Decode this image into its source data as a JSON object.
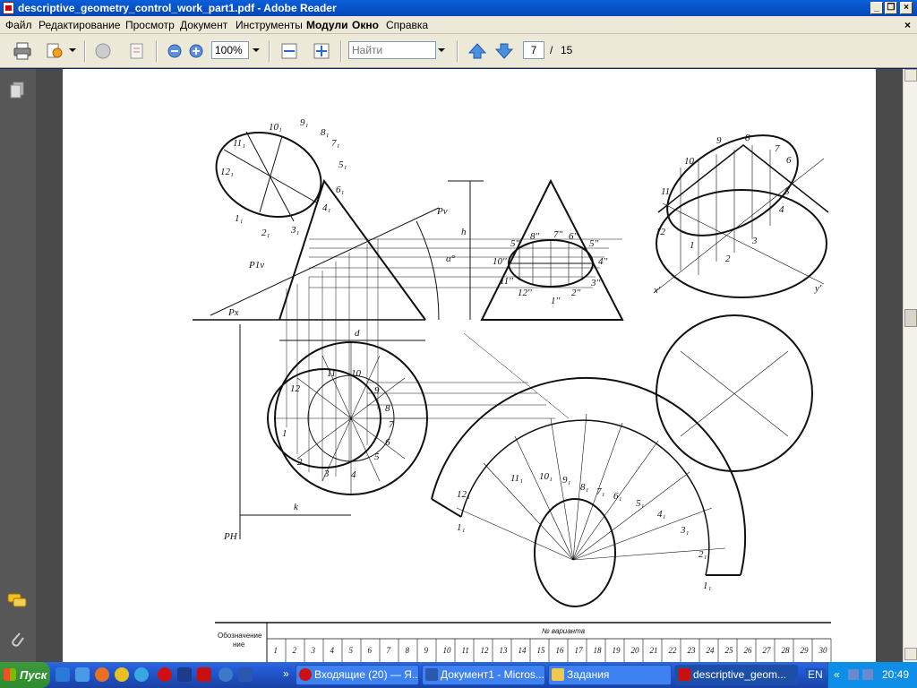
{
  "window": {
    "title": "descriptive_geometry_control_work_part1.pdf - Adobe Reader"
  },
  "menu": {
    "items": [
      "Файл",
      "Редактирование",
      "Просмотр",
      "Документ",
      "Инструменты",
      "Модули",
      "Окно",
      "Справка"
    ],
    "close_glyph": "×"
  },
  "toolbar": {
    "zoom_value": "100%",
    "search_placeholder": "Найти",
    "page_current": "7",
    "page_separator": "/",
    "page_total": "15"
  },
  "drawing": {
    "labels_front": [
      "11₁",
      "10₁",
      "9₁",
      "8₁",
      "7₁",
      "12₁",
      "5₁",
      "6₁",
      "4₁",
      "1₁",
      "2₁",
      "3₁",
      "Pv",
      "P1v",
      "h",
      "α°",
      "Px",
      "d",
      "k",
      "PH"
    ],
    "labels_top": [
      "11",
      "10",
      "12",
      "1",
      "2",
      "3",
      "4",
      "5",
      "6",
      "7",
      "8",
      "9"
    ],
    "labels_side": [
      "5''",
      "8''",
      "7''",
      "6''",
      "5''",
      "4''",
      "10''",
      "11''",
      "12''",
      "1''",
      "2''",
      "3''"
    ],
    "labels_iso": [
      "9",
      "8",
      "7",
      "6",
      "10",
      "11",
      "5",
      "4",
      "12",
      "3",
      "1",
      "2",
      "x'",
      "y'"
    ],
    "labels_dev": [
      "12₁",
      "11₁",
      "10₁",
      "9₁",
      "8₁",
      "7₁",
      "6₁",
      "5₁",
      "4₁",
      "3₁",
      "2₁",
      "1₁",
      "1₁"
    ]
  },
  "table": {
    "row_header": "Обозначение",
    "row_header_2": "ние",
    "caption": "№ варианта",
    "variants": [
      "1",
      "2",
      "3",
      "4",
      "5",
      "6",
      "7",
      "8",
      "9",
      "10",
      "11",
      "12",
      "13",
      "14",
      "15",
      "16",
      "17",
      "18",
      "19",
      "20",
      "21",
      "22",
      "23",
      "24",
      "25",
      "26",
      "27",
      "28",
      "29",
      "30"
    ]
  },
  "taskbar": {
    "start_label": "Пуск",
    "tasks": [
      "Входящие (20) — Я...",
      "Документ1 - Micros...",
      "Задания",
      "descriptive_geom..."
    ],
    "lang": "EN",
    "clock": "20:49"
  }
}
